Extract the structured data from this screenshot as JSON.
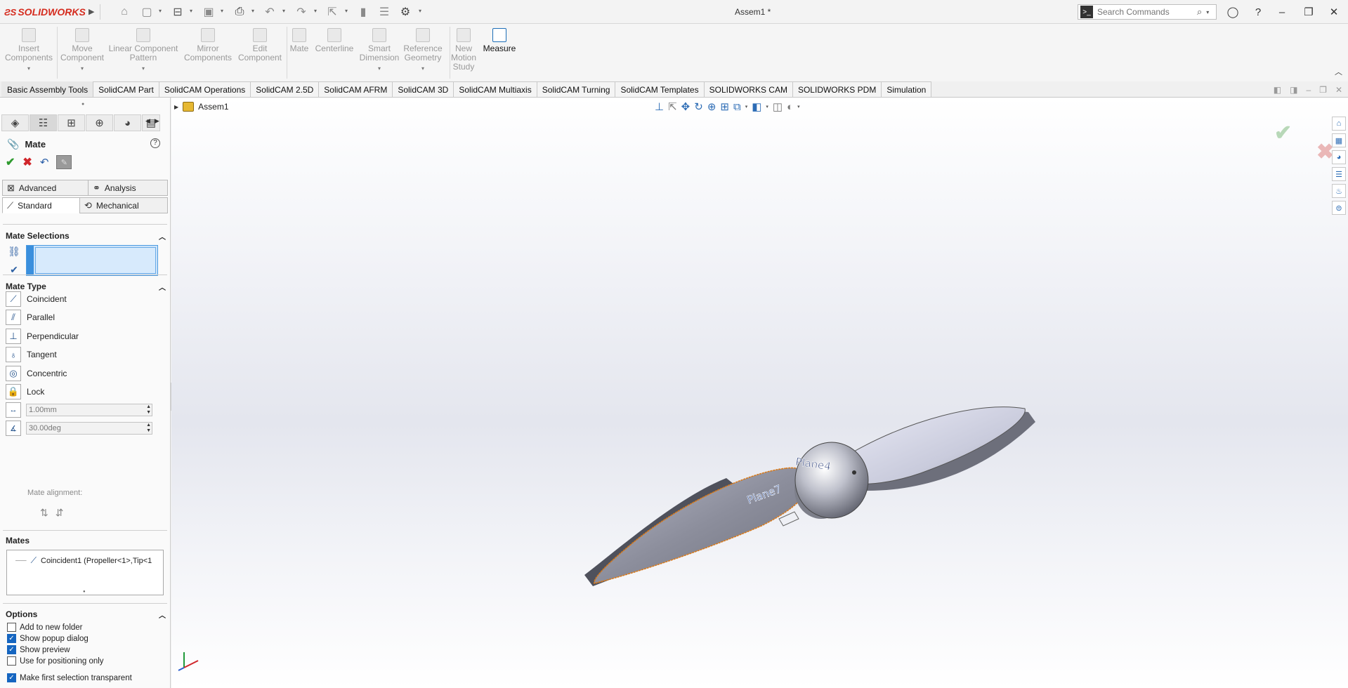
{
  "app": {
    "logo_text": "SOLIDWORKS",
    "document_title": "Assem1 *"
  },
  "search": {
    "placeholder": "Search Commands"
  },
  "ribbon": {
    "buttons": [
      {
        "label": "Insert Components"
      },
      {
        "label": "Move Component"
      },
      {
        "label": "Linear Component Pattern"
      },
      {
        "label": "Mirror Components"
      },
      {
        "label": "Edit Component"
      },
      {
        "label": "Mate"
      },
      {
        "label": "Centerline"
      },
      {
        "label": "Smart Dimension"
      },
      {
        "label": "Reference Geometry"
      },
      {
        "label": "New Motion Study"
      },
      {
        "label": "Measure"
      }
    ]
  },
  "tabs": [
    "Basic Assembly Tools",
    "SolidCAM Part",
    "SolidCAM Operations",
    "SolidCAM 2.5D",
    "SolidCAM AFRM",
    "SolidCAM 3D",
    "SolidCAM Multiaxis",
    "SolidCAM Turning",
    "SolidCAM Templates",
    "SOLIDWORKS CAM",
    "SOLIDWORKS PDM",
    "Simulation"
  ],
  "property_manager": {
    "title": "Mate",
    "mate_tabs": {
      "advanced": "Advanced",
      "analysis": "Analysis",
      "standard": "Standard",
      "mechanical": "Mechanical"
    },
    "sections": {
      "mate_selections": "Mate Selections",
      "mate_type": "Mate Type",
      "mates": "Mates",
      "options": "Options"
    },
    "mate_types": [
      "Coincident",
      "Parallel",
      "Perpendicular",
      "Tangent",
      "Concentric",
      "Lock"
    ],
    "distance_value": "1.00mm",
    "angle_value": "30.00deg",
    "mate_alignment_label": "Mate alignment:",
    "mates_list": [
      "Coincident1 (Propeller<1>,Tip<1"
    ],
    "options": [
      {
        "label": "Add to new folder",
        "checked": false
      },
      {
        "label": "Show popup dialog",
        "checked": true
      },
      {
        "label": "Show preview",
        "checked": true
      },
      {
        "label": "Use for positioning only",
        "checked": false
      },
      {
        "label": "Make first selection transparent",
        "checked": true
      }
    ]
  },
  "graphics": {
    "tree_root": "Assem1",
    "plane_labels": [
      "Plane7",
      "Plane4"
    ]
  },
  "colors": {
    "brand": "#d52b1e",
    "accent": "#1565c0",
    "selection_fill": "#cde4fa"
  }
}
